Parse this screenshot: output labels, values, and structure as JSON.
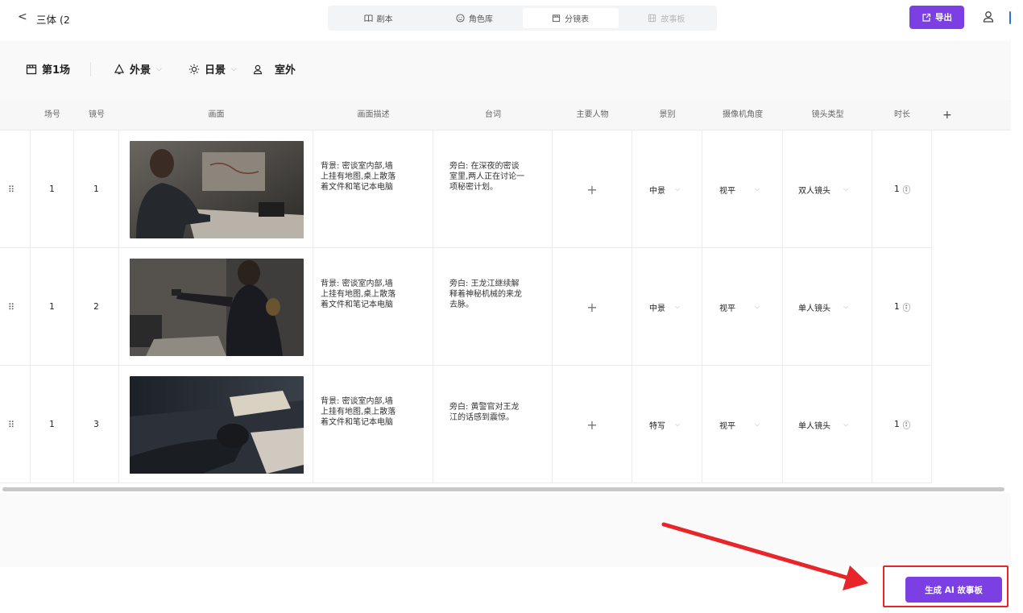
{
  "header": {
    "back_symbol": "<",
    "project_title": "三体 (2",
    "tabs": [
      {
        "label": "剧本",
        "icon": "book-icon",
        "state": "normal"
      },
      {
        "label": "角色库",
        "icon": "smile-icon",
        "state": "normal"
      },
      {
        "label": "分镜表",
        "icon": "clapperboard-icon",
        "state": "active"
      },
      {
        "label": "故事板",
        "icon": "film-icon",
        "state": "disabled"
      }
    ],
    "export_label": "导出"
  },
  "scene": {
    "number_label": "第1场",
    "exterior_label": "外景",
    "time_label": "日景",
    "location_label": "室外"
  },
  "table": {
    "columns": [
      "场号",
      "镜号",
      "画面",
      "画面描述",
      "台词",
      "主要人物",
      "景别",
      "摄像机角度",
      "镜头类型",
      "时长"
    ],
    "add_column_symbol": "+",
    "rows": [
      {
        "scene_no": "1",
        "shot_no": "1",
        "description": "背景: 密谈室内部,墙\n上挂有地图,桌上散落\n着文件和笔记本电脑",
        "dialogue": "旁白: 在深夜的密谈\n室里,两人正在讨论一\n项秘密计划。",
        "add_symbol": "+",
        "shot_size": "中景",
        "camera_angle": "视平",
        "lens_type": "双人镜头",
        "duration": "1"
      },
      {
        "scene_no": "1",
        "shot_no": "2",
        "description": "背景: 密谈室内部,墙\n上挂有地图,桌上散落\n着文件和笔记本电脑",
        "dialogue": "旁白: 王龙江继续解\n释着神秘机械的来龙\n去脉。",
        "add_symbol": "+",
        "shot_size": "中景",
        "camera_angle": "视平",
        "lens_type": "单人镜头",
        "duration": "1"
      },
      {
        "scene_no": "1",
        "shot_no": "3",
        "description": "背景: 密谈室内部,墙\n上挂有地图,桌上散落\n着文件和笔记本电脑",
        "dialogue": "旁白: 黄警官对王龙\n江的话感到震惊。",
        "add_symbol": "+",
        "shot_size": "特写",
        "camera_angle": "视平",
        "lens_type": "单人镜头",
        "duration": "1"
      }
    ]
  },
  "footer": {
    "generate_label": "生成 AI 故事板"
  },
  "colors": {
    "accent": "#7b3fe4",
    "highlight_box": "#e8262a",
    "annotation_arrow": "#e8262a"
  }
}
